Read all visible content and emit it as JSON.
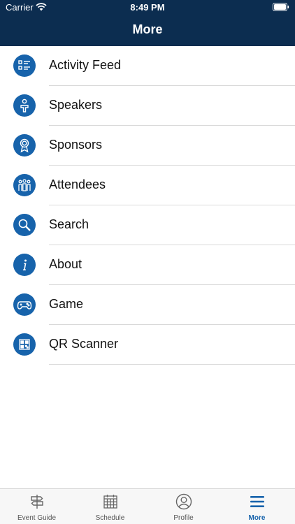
{
  "status_bar": {
    "carrier": "Carrier",
    "time": "8:49 PM"
  },
  "header": {
    "title": "More"
  },
  "menu": {
    "items": [
      {
        "label": "Activity Feed",
        "icon": "activity-feed-icon"
      },
      {
        "label": "Speakers",
        "icon": "speaker-icon"
      },
      {
        "label": "Sponsors",
        "icon": "award-ribbon-icon"
      },
      {
        "label": "Attendees",
        "icon": "people-group-icon"
      },
      {
        "label": "Search",
        "icon": "magnifier-icon"
      },
      {
        "label": "About",
        "icon": "info-icon"
      },
      {
        "label": "Game",
        "icon": "gamepad-icon"
      },
      {
        "label": "QR Scanner",
        "icon": "qr-code-icon"
      }
    ]
  },
  "tabbar": {
    "tabs": [
      {
        "label": "Event Guide",
        "icon": "signpost-icon",
        "active": false
      },
      {
        "label": "Schedule",
        "icon": "calendar-icon",
        "active": false
      },
      {
        "label": "Profile",
        "icon": "user-circle-icon",
        "active": false
      },
      {
        "label": "More",
        "icon": "hamburger-menu-icon",
        "active": true
      }
    ]
  },
  "colors": {
    "header": "#0c2d50",
    "accent": "#1763ab",
    "separator": "#d9d9d9"
  }
}
